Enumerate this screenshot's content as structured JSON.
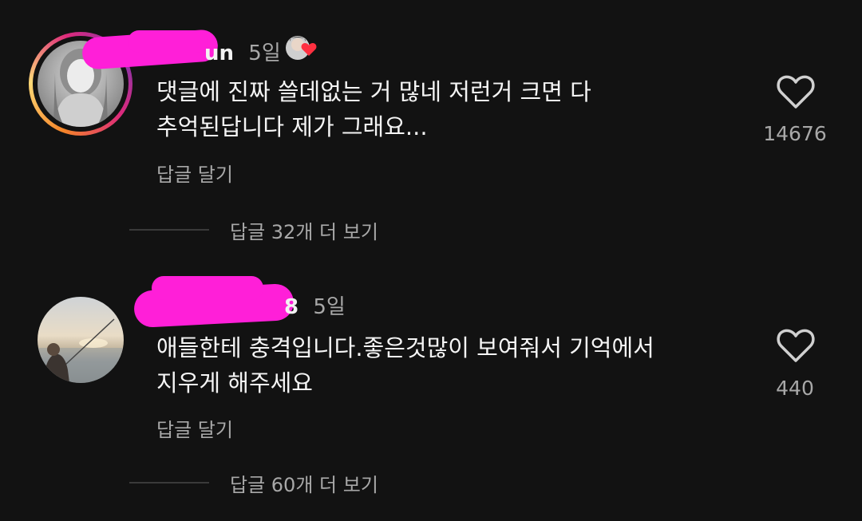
{
  "comments": [
    {
      "username_visible": "un",
      "time": "5일",
      "text_line1": "댓글에 진짜 쓸데없는 거 많네 저런거 크면 다",
      "text_line2": "추억된답니다 제가 그래요...",
      "reply_label": "답글 달기",
      "likes": "14676",
      "view_replies": "답글 32개 더 보기",
      "has_story_ring": true
    },
    {
      "username_visible": "8",
      "time": "5일",
      "text_line1": "애들한테 충격입니다.좋은것많이 보여줘서 기억에서",
      "text_line2": "지우게 해주세요",
      "reply_label": "답글 달기",
      "likes": "440",
      "view_replies": "답글 60개 더 보기",
      "has_story_ring": false
    }
  ],
  "icons": {
    "like": "heart-outline-icon",
    "reaction_badge": "avatar-heart-badge-icon"
  },
  "colors": {
    "background": "#121212",
    "redaction": "#ff1fd8",
    "secondary_text": "#a8a8a8"
  }
}
